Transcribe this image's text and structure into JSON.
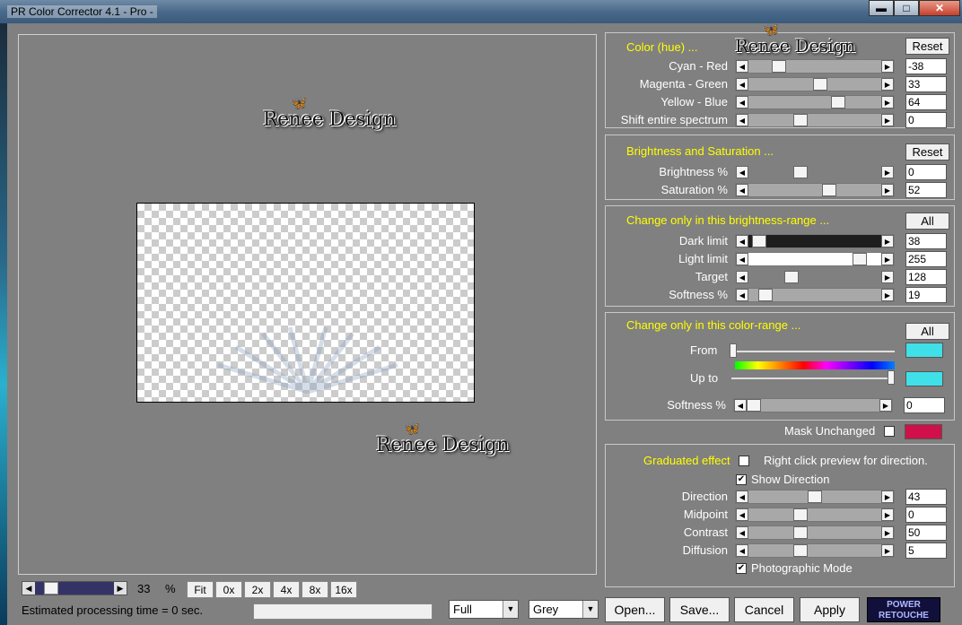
{
  "window": {
    "title": "PR Color Corrector 4.1  - Pro -",
    "min": "▬",
    "max": "□",
    "close": "✕"
  },
  "watermark": "Renee Design",
  "zoom": {
    "value": "33",
    "unit": "%",
    "buttons": [
      "Fit",
      "0x",
      "2x",
      "4x",
      "8x",
      "16x"
    ]
  },
  "status": {
    "est_time": "Estimated processing time =  0 sec."
  },
  "combos": {
    "mode": "Full",
    "background": "Grey"
  },
  "buttons": {
    "open": "Open...",
    "save": "Save...",
    "cancel": "Cancel",
    "apply": "Apply"
  },
  "brand": {
    "line1": "POWER",
    "line2": "RETOUCHE"
  },
  "hue": {
    "title": "Color (hue) ...",
    "reset": "Reset",
    "rows": [
      {
        "label": "Cyan - Red",
        "value": "-38"
      },
      {
        "label": "Magenta - Green",
        "value": "33"
      },
      {
        "label": "Yellow - Blue",
        "value": "64"
      },
      {
        "label": "Shift entire spectrum",
        "value": "0"
      }
    ]
  },
  "bs": {
    "title": "Brightness and Saturation ...",
    "reset": "Reset",
    "rows": [
      {
        "label": "Brightness %",
        "value": "0"
      },
      {
        "label": "Saturation %",
        "value": "52"
      }
    ]
  },
  "brange": {
    "title": "Change only in this brightness-range ...",
    "all": "All",
    "rows": [
      {
        "label": "Dark limit",
        "value": "38"
      },
      {
        "label": "Light limit",
        "value": "255"
      },
      {
        "label": "Target",
        "value": "128"
      },
      {
        "label": "Softness %",
        "value": "19"
      }
    ]
  },
  "crange": {
    "title": "Change only in this color-range ...",
    "all": "All",
    "from": "From",
    "upto": "Up to",
    "softness_label": "Softness %",
    "softness_value": "0",
    "swatch_color": "#40e0e8"
  },
  "mask": {
    "label": "Mask Unchanged",
    "color": "#d0104a"
  },
  "graduated": {
    "label": "Graduated effect",
    "hint": "Right click preview for direction.",
    "show_direction": "Show Direction",
    "photographic": "Photographic Mode",
    "rows": [
      {
        "label": "Direction",
        "value": "43"
      },
      {
        "label": "Midpoint",
        "value": "0"
      },
      {
        "label": "Contrast",
        "value": "50"
      },
      {
        "label": "Diffusion",
        "value": "5"
      }
    ]
  }
}
